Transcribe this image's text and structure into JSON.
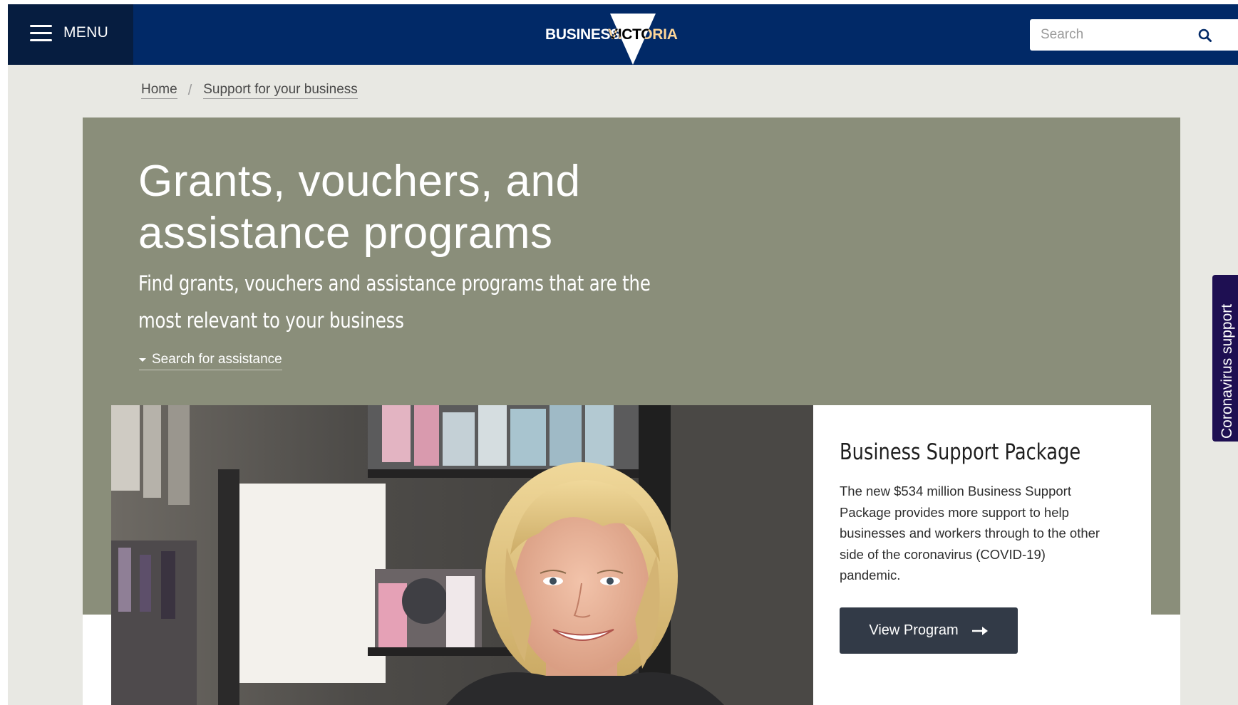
{
  "header": {
    "menu_label": "MENU",
    "logo": {
      "text_left": "BUSINESS",
      "text_right": "VICTORIA",
      "accent": "#ffffff"
    },
    "search": {
      "placeholder": "Search",
      "value": ""
    },
    "colors": {
      "bar": "#012967",
      "menu": "#061d40"
    }
  },
  "breadcrumb": {
    "items": [
      "Home",
      "Support for your business"
    ],
    "separator": "/"
  },
  "hero": {
    "title": "Grants, vouchers, and assistance programs",
    "subtitle": "Find grants, vouchers and assistance programs that are the most relevant to your business",
    "search_link": "Search for assistance",
    "background": "#8a8e7a"
  },
  "feature": {
    "title": "Business Support Package",
    "body": "The new $534 million Business Support Package provides more support to help businesses and workers through to the other side of the coronavirus (COVID-19) pandemic.",
    "button_label": "View Program",
    "button_icon": "arrow-right-icon",
    "image_alt": "smiling-woman-in-salon"
  },
  "side_tab": {
    "label": "Coronavirus support",
    "color": "#1e0f52"
  }
}
